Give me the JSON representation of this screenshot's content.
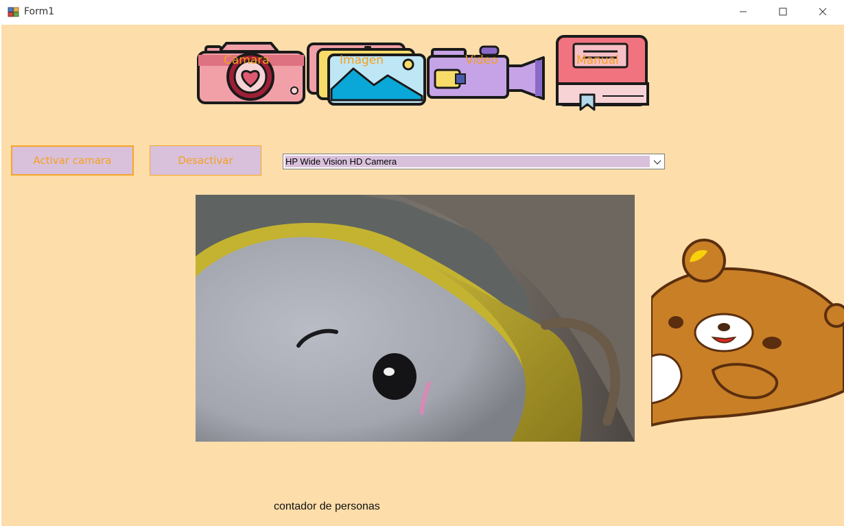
{
  "window": {
    "title": "Form1"
  },
  "toolbar": {
    "items": [
      {
        "label": "Camara",
        "icon": "camera-icon"
      },
      {
        "label": "Imagen",
        "icon": "image-icon"
      },
      {
        "label": "Video",
        "icon": "video-camera-icon"
      },
      {
        "label": "Manual",
        "icon": "book-icon"
      }
    ]
  },
  "controls": {
    "activate_label": "Activar camara",
    "deactivate_label": "Desactivar",
    "camera_select_value": "HP Wide Vision HD Camera"
  },
  "footer": {
    "counter_label": "contador de personas"
  },
  "colors": {
    "background": "#fdddaa",
    "button_fill": "#d9c1dc",
    "button_text": "#f5a01e",
    "button_border": "#f5a623"
  }
}
